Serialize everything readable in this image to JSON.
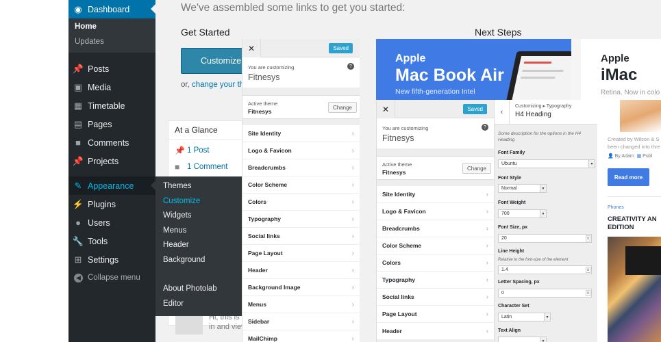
{
  "adminmenu": {
    "items": [
      {
        "label": "Dashboard",
        "icon": "dashboard-icon"
      },
      {
        "label": "Posts",
        "icon": "pin-icon"
      },
      {
        "label": "Media",
        "icon": "media-icon"
      },
      {
        "label": "Timetable",
        "icon": "calendar-icon"
      },
      {
        "label": "Pages",
        "icon": "pages-icon"
      },
      {
        "label": "Comments",
        "icon": "comment-icon"
      },
      {
        "label": "Projects",
        "icon": "pin-icon"
      },
      {
        "label": "Appearance",
        "icon": "brush-icon"
      },
      {
        "label": "Plugins",
        "icon": "plug-icon"
      },
      {
        "label": "Users",
        "icon": "users-icon"
      },
      {
        "label": "Tools",
        "icon": "wrench-icon"
      },
      {
        "label": "Settings",
        "icon": "settings-icon"
      }
    ],
    "dashboard_sub": [
      "Home",
      "Updates"
    ],
    "collapse": "Collapse menu",
    "appearance_sub": [
      "Themes",
      "Customize",
      "Widgets",
      "Menus",
      "Header",
      "Background",
      "About Photolab",
      "Editor"
    ]
  },
  "dashboard": {
    "intro": "We've assembled some links to get you started:",
    "get_started": "Get Started",
    "next_steps": "Next Steps",
    "customize_btn": "Customize Y",
    "or_prefix": "or, ",
    "or_link": "change your the",
    "glance_title": "At a Glance",
    "glance_posts": "1 Post",
    "glance_comments": "1 Comment",
    "comment_line1": "Hi, this is c",
    "comment_line2": "in and view"
  },
  "customizer": {
    "saved": "Saved",
    "you_are_customizing": "You are customizing",
    "site_name": "Fitnesys",
    "active_theme": "Active theme",
    "theme_name": "Fitnesys",
    "change": "Change",
    "sections_1": [
      "Site Identity",
      "Logo & Favicon",
      "Breadcrumbs",
      "Color Scheme",
      "Colors",
      "Typography",
      "Social links",
      "Page Layout",
      "Header",
      "Background Image",
      "Menus",
      "Sidebar",
      "MailChimp"
    ],
    "sections_2": [
      "Site Identity",
      "Logo & Favicon",
      "Breadcrumbs",
      "Color Scheme",
      "Colors",
      "Typography",
      "Social links",
      "Page Layout",
      "Header"
    ]
  },
  "typography": {
    "crumb": "Customizing ▸ Typography",
    "title": "H4 Heading",
    "description": "Some description for the options in the H4 Heading",
    "font_family_label": "Font Family",
    "font_family": "Ubuntu",
    "font_style_label": "Font Style",
    "font_style": "Normal",
    "font_weight_label": "Font Weight",
    "font_weight": "700",
    "font_size_label": "Font Size, px",
    "font_size": "20",
    "line_height_label": "Line Height",
    "line_height_sub": "Relative to the font-size of the element",
    "line_height": "1.4",
    "letter_spacing_label": "Letter Spacing, px",
    "letter_spacing": "0",
    "charset_label": "Character Set",
    "charset": "Latin",
    "text_align_label": "Text Align"
  },
  "preview": {
    "a_brand": "Apple",
    "a_product": "Mac Book Air",
    "a_tagline": "New fifth-generation Intel",
    "b_brand": "Apple",
    "b_product": "iMac",
    "b_tagline": "Retina. Now in colo",
    "meta1": "Created by Wilson & S",
    "meta2": "been changed into thre",
    "by": "By Adam",
    "pub": "Publ",
    "read_more": "Read more",
    "category": "Phones",
    "headline1": "CREATIVITY AN",
    "headline2": "EDITION"
  },
  "colors": {
    "wp_sidebar": "#23282d",
    "wp_accent": "#0073aa",
    "wp_highlight": "#00b9eb",
    "preview_blue": "#3f7ae5",
    "saved_btn": "#2ea2cc"
  }
}
